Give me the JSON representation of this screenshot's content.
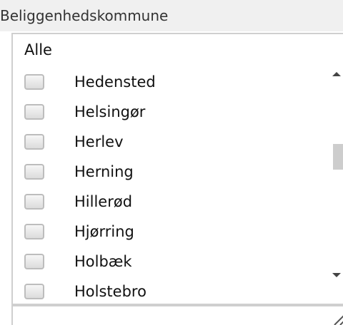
{
  "field_label": "Beliggenhedskommune",
  "filter": {
    "value": "Alle"
  },
  "list": {
    "items": [
      {
        "label": "Hedensted",
        "checked": false
      },
      {
        "label": "Helsingør",
        "checked": false
      },
      {
        "label": "Herlev",
        "checked": false
      },
      {
        "label": "Herning",
        "checked": false
      },
      {
        "label": "Hillerød",
        "checked": false
      },
      {
        "label": "Hjørring",
        "checked": false
      },
      {
        "label": "Holbæk",
        "checked": false
      },
      {
        "label": "Holstebro",
        "checked": false
      }
    ]
  },
  "scrollbar": {
    "up_icon": "arrow-up-icon",
    "down_icon": "arrow-down-icon"
  },
  "colors": {
    "border": "#cfcfcf",
    "header_bg": "#f0f0f0",
    "thumb": "#cdcdcd"
  }
}
